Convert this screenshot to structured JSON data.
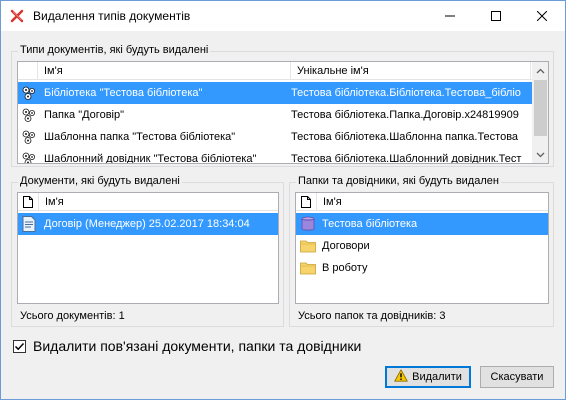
{
  "window": {
    "title": "Видалення типів документів"
  },
  "doc_types_group": {
    "label": "Типи документів, які будуть видалені",
    "columns": [
      "Ім'я",
      "Унікальне ім'я"
    ],
    "rows": [
      {
        "name": "Бібліотека \"Тестова бібліотека\"",
        "unique": "Тестова бібліотека.Бібліотека.Тестова_бібліо",
        "icon": "gear-cluster-icon",
        "selected": true
      },
      {
        "name": "Папка \"Договір\"",
        "unique": "Тестова бібліотека.Папка.Договір.x24819909",
        "icon": "gear-cluster-icon",
        "selected": false
      },
      {
        "name": "Шаблонна папка \"Тестова бібліотека\"",
        "unique": "Тестова бібліотека.Шаблонна папка.Тестова",
        "icon": "gear-cluster-icon",
        "selected": false
      },
      {
        "name": "Шаблонний довідник \"Тестова бібліотека\"",
        "unique": "Тестова бібліотека.Шаблонний довідник.Тест",
        "icon": "gear-cluster-icon",
        "selected": false
      }
    ]
  },
  "documents_group": {
    "label": "Документи, які будуть видалені",
    "column": "Ім'я",
    "rows": [
      {
        "name": "Договір (Менеджер) 25.02.2017 18:34:04",
        "selected": true
      }
    ],
    "summary": "Усього документів: 1"
  },
  "folders_group": {
    "label": "Папки та довідники, які будуть видален",
    "column": "Ім'я",
    "rows": [
      {
        "name": "Тестова бібліотека",
        "icon": "library-icon",
        "selected": true
      },
      {
        "name": "Договори",
        "icon": "folder-icon",
        "selected": false
      },
      {
        "name": "В роботу",
        "icon": "folder-icon",
        "selected": false
      }
    ],
    "summary": "Усього папок та довідників: 3"
  },
  "delete_related": {
    "label": "Видалити пов'язані документи, папки та довідники",
    "checked": true
  },
  "buttons": {
    "delete": "Видалити",
    "cancel": "Скасувати"
  },
  "colors": {
    "selection": "#3399ff",
    "accent": "#0078d7"
  }
}
